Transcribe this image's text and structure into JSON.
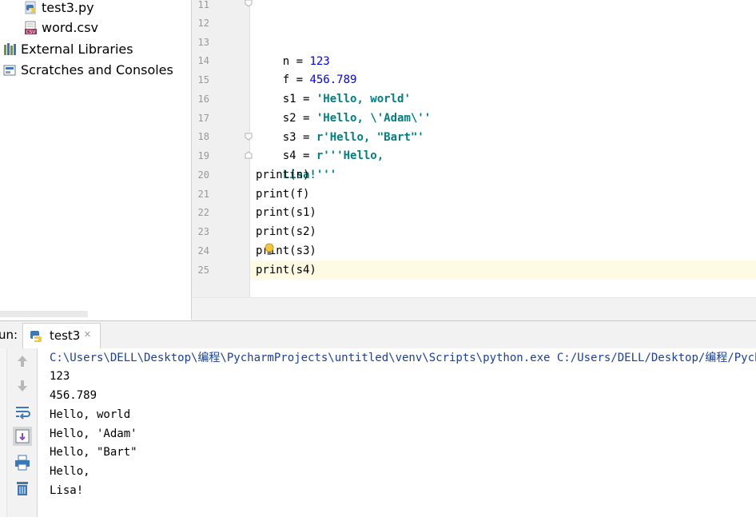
{
  "project_tree": {
    "items": [
      {
        "label": "test3.py",
        "icon": "python-file-icon"
      },
      {
        "label": "word.csv",
        "icon": "csv-file-icon"
      },
      {
        "label": "External Libraries",
        "icon": "libraries-icon"
      },
      {
        "label": "Scratches and Consoles",
        "icon": "scratches-icon"
      }
    ]
  },
  "editor": {
    "line_numbers": [
      "11",
      "12",
      "13",
      "14",
      "15",
      "16",
      "17",
      "18",
      "19",
      "20",
      "21",
      "22",
      "23",
      "24",
      "25"
    ],
    "lines": [
      {
        "num": "11",
        "code": ""
      },
      {
        "num": "12",
        "code": ""
      },
      {
        "num": "13",
        "code": "n = 123"
      },
      {
        "num": "14",
        "code": "f = 456.789"
      },
      {
        "num": "15",
        "code": "s1 = 'Hello, world'"
      },
      {
        "num": "16",
        "code": "s2 = 'Hello, \\'Adam\\''"
      },
      {
        "num": "17",
        "code": "s3 = r'Hello, \"Bart\"'"
      },
      {
        "num": "18",
        "code": "s4 = r'''Hello,"
      },
      {
        "num": "19",
        "code": "Lisa!'''"
      },
      {
        "num": "20",
        "code": "print(n)"
      },
      {
        "num": "21",
        "code": "print(f)"
      },
      {
        "num": "22",
        "code": "print(s1)"
      },
      {
        "num": "23",
        "code": "print(s2)"
      },
      {
        "num": "24",
        "code": "print(s3)"
      },
      {
        "num": "25",
        "code": "print(s4)"
      }
    ],
    "tokens": {
      "l13_a": "n = ",
      "l13_n": "123",
      "l14_a": "f = ",
      "l14_n": "456.789",
      "l15_a": "s1 = ",
      "l15_s": "'Hello, world'",
      "l16_a": "s2 = ",
      "l16_s": "'Hello, \\'Adam\\''",
      "l17_a": "s3 = ",
      "l17_s": "r'Hello, \"Bart\"'",
      "l18_a": "s4 = ",
      "l18_s": "r'''Hello,",
      "l19_s": "Lisa!'''",
      "l20": "print(n)",
      "l21": "print(f)",
      "l22": "print(s1)",
      "l23": "print(s2)",
      "l24": "print(s3)",
      "l25": "print(s4)"
    }
  },
  "run_panel": {
    "title": "un:",
    "tab_label": "test3",
    "tab_close": "×",
    "console": [
      "C:\\Users\\DELL\\Desktop\\编程\\PycharmProjects\\untitled\\venv\\Scripts\\python.exe C:/Users/DELL/Desktop/编程/PycharmP",
      "123",
      "456.789",
      "Hello, world",
      "Hello, 'Adam'",
      "Hello, \"Bart\"",
      "Hello,",
      "Lisa!"
    ],
    "toolbar": [
      "up-arrow-icon",
      "down-arrow-icon",
      "soft-wrap-icon",
      "scroll-to-end-icon",
      "print-icon",
      "trash-icon"
    ]
  },
  "colors": {
    "number": "#0000ff",
    "string": "#008080",
    "caret_line": "#fffae3",
    "command": "#1a3fa0"
  }
}
